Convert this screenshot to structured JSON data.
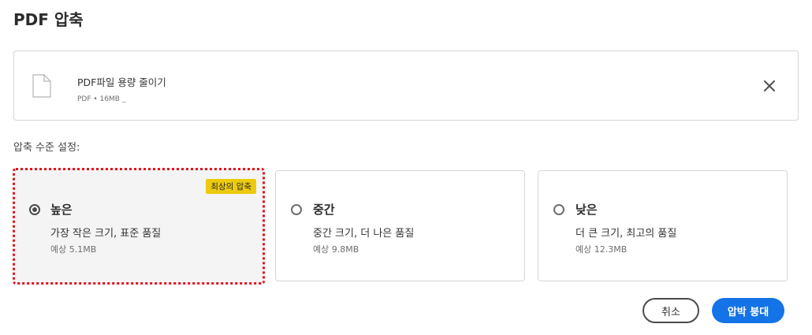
{
  "dialog": {
    "title": "PDF 압축"
  },
  "file": {
    "name": "PDF파일 용량 줄이기",
    "meta": "PDF • 16MB _",
    "icon": "document-icon",
    "close_icon": "close-icon"
  },
  "compression": {
    "label": "압축 수준 설정:",
    "options": [
      {
        "title": "높은",
        "description": "가장 작은 크기, 표준 품질",
        "size": "예상 5.1MB",
        "badge": "최상의 압축",
        "selected": true
      },
      {
        "title": "중간",
        "description": "중간 크기, 더 나은 품질",
        "size": "예상 9.8MB",
        "selected": false
      },
      {
        "title": "낮은",
        "description": "더 큰 크기, 최고의 품질",
        "size": "예상 12.3MB",
        "selected": false
      }
    ]
  },
  "footer": {
    "cancel_label": "취소",
    "compress_label": "압박 붕대"
  },
  "colors": {
    "accent": "#1473e6",
    "badge": "#eccb0e",
    "selection_outline": "#e2151b"
  }
}
